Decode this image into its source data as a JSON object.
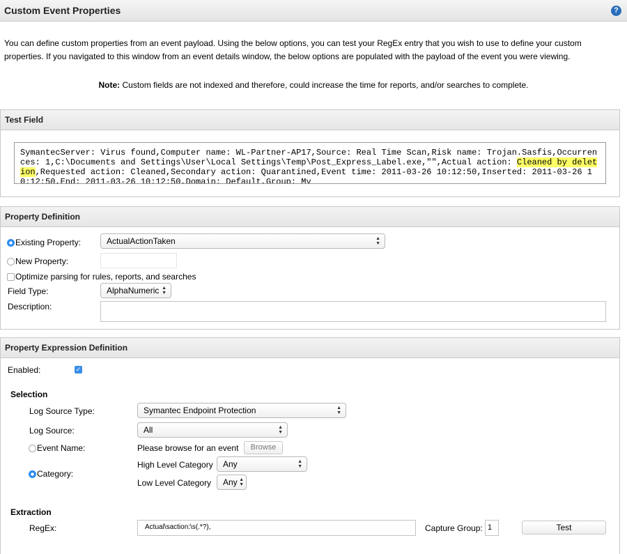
{
  "header": {
    "title": "Custom Event Properties",
    "help_icon": "?"
  },
  "intro": "You can define custom properties from an event payload. Using the below options, you can test your RegEx entry that you wish to use to define your custom properties. If you navigated to this window from an event details window, the below options are populated with the payload of the event you were viewing.",
  "note": {
    "label": "Note:",
    "text": " Custom fields are not indexed and therefore, could increase the time for reports, and/or searches to complete."
  },
  "test_field": {
    "title": "Test Field",
    "payload_before": "SymantecServer: Virus found,Computer name: WL-Partner-AP17,Source: Real Time Scan,Risk name: Trojan.Sasfis,Occurrences: 1,C:\\Documents and Settings\\User\\Local Settings\\Temp\\Post_Express_Label.exe,\"\",Actual action: ",
    "payload_highlight": "Cleaned by deletion",
    "payload_after": ",Requested action: Cleaned,Secondary action: Quarantined,Event time: 2011-03-26 10:12:50,Inserted: 2011-03-26 10:12:50,End: 2011-03-26 10:12:50,Domain: Default,Group: My"
  },
  "property_definition": {
    "title": "Property Definition",
    "existing_label": "Existing Property:",
    "existing_value": "ActualActionTaken",
    "new_label": "New Property:",
    "new_value": "",
    "optimize_label": "Optimize parsing for rules, reports, and searches",
    "field_type_label": "Field Type:",
    "field_type_value": "AlphaNumeric",
    "description_label": "Description:",
    "description_value": ""
  },
  "expression_definition": {
    "title": "Property Expression Definition",
    "enabled_label": "Enabled:",
    "selection_heading": "Selection",
    "log_source_type_label": "Log Source Type:",
    "log_source_type_value": "Symantec Endpoint Protection",
    "log_source_label": "Log Source:",
    "log_source_value": "All",
    "event_name_label": "Event Name:",
    "event_name_prompt": "Please browse for an event",
    "browse_label": "Browse",
    "category_label": "Category:",
    "high_level_label": "High Level Category",
    "high_level_value": "Any",
    "low_level_label": "Low Level Category",
    "low_level_value": "Any",
    "extraction_heading": "Extraction",
    "regex_label": "RegEx:",
    "regex_value": "Actual\\saction:\\s(.*?),",
    "capture_group_label": "Capture Group:",
    "capture_group_value": "1",
    "test_label": "Test"
  }
}
